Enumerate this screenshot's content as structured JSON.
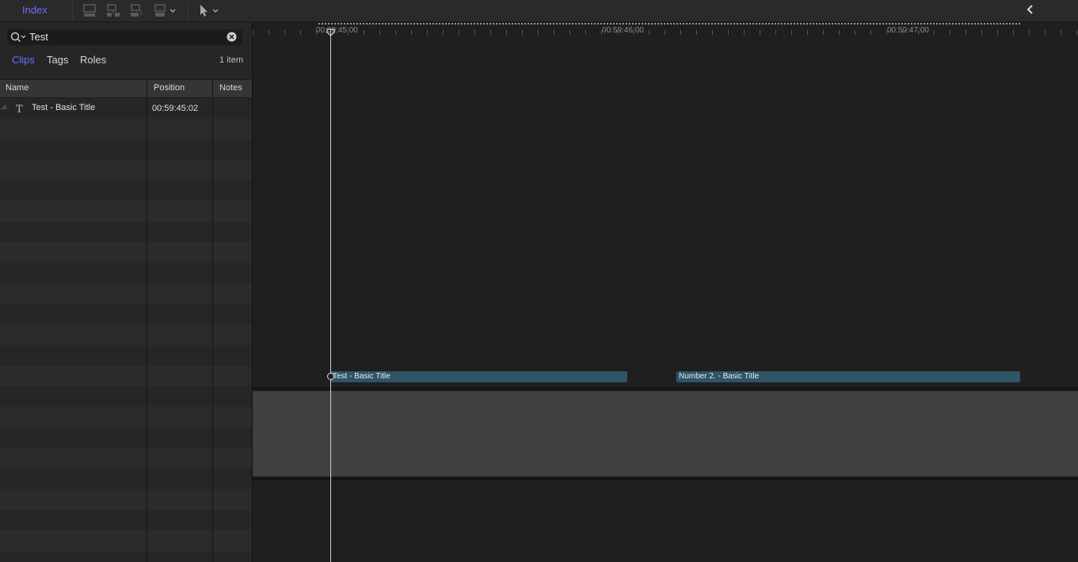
{
  "toolbar": {
    "index_label": "Index",
    "icons": [
      "connect-clip-icon",
      "insert-clip-icon",
      "append-clip-icon",
      "overwrite-clip-icon",
      "select-tool-icon"
    ],
    "collapse_icon": "chevron-left-icon"
  },
  "index": {
    "search": {
      "value": "Test",
      "icon": "search-icon",
      "clear_icon": "clear-icon"
    },
    "tabs": [
      {
        "label": "Clips",
        "active": true
      },
      {
        "label": "Tags",
        "active": false
      },
      {
        "label": "Roles",
        "active": false
      }
    ],
    "item_count": "1 item",
    "columns": [
      "Name",
      "Position",
      "Notes"
    ],
    "rows": [
      {
        "icon": "title-icon",
        "name": "Test - Basic Title",
        "position": "00:59:45:02",
        "notes": ""
      }
    ]
  },
  "timeline": {
    "ruler_labels": [
      "00:59:45:00",
      "00:59:46:00",
      "00:59:47:00"
    ],
    "clips": [
      {
        "label": "Test - Basic Title"
      },
      {
        "label": "Number 2. - Basic Title"
      }
    ]
  },
  "colors": {
    "accent": "#6d6dff",
    "clip": "#2f5367",
    "storyline": "#404040"
  }
}
